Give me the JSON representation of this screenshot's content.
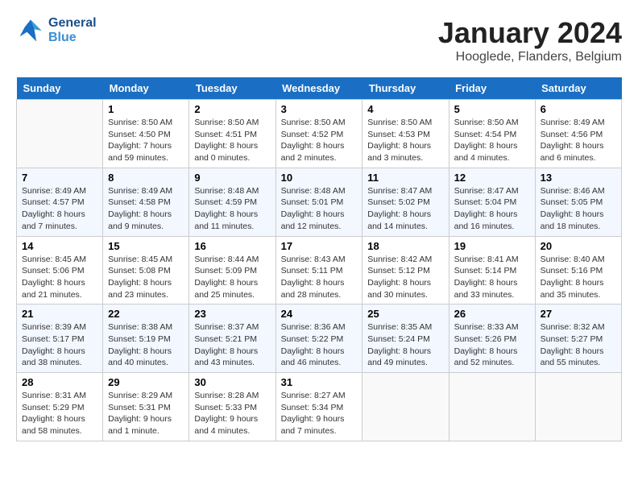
{
  "header": {
    "logo_line1": "General",
    "logo_line2": "Blue",
    "month_year": "January 2024",
    "location": "Hooglede, Flanders, Belgium"
  },
  "weekdays": [
    "Sunday",
    "Monday",
    "Tuesday",
    "Wednesday",
    "Thursday",
    "Friday",
    "Saturday"
  ],
  "weeks": [
    [
      {
        "day": "",
        "sunrise": "",
        "sunset": "",
        "daylight": ""
      },
      {
        "day": "1",
        "sunrise": "Sunrise: 8:50 AM",
        "sunset": "Sunset: 4:50 PM",
        "daylight": "Daylight: 7 hours and 59 minutes."
      },
      {
        "day": "2",
        "sunrise": "Sunrise: 8:50 AM",
        "sunset": "Sunset: 4:51 PM",
        "daylight": "Daylight: 8 hours and 0 minutes."
      },
      {
        "day": "3",
        "sunrise": "Sunrise: 8:50 AM",
        "sunset": "Sunset: 4:52 PM",
        "daylight": "Daylight: 8 hours and 2 minutes."
      },
      {
        "day": "4",
        "sunrise": "Sunrise: 8:50 AM",
        "sunset": "Sunset: 4:53 PM",
        "daylight": "Daylight: 8 hours and 3 minutes."
      },
      {
        "day": "5",
        "sunrise": "Sunrise: 8:50 AM",
        "sunset": "Sunset: 4:54 PM",
        "daylight": "Daylight: 8 hours and 4 minutes."
      },
      {
        "day": "6",
        "sunrise": "Sunrise: 8:49 AM",
        "sunset": "Sunset: 4:56 PM",
        "daylight": "Daylight: 8 hours and 6 minutes."
      }
    ],
    [
      {
        "day": "7",
        "sunrise": "Sunrise: 8:49 AM",
        "sunset": "Sunset: 4:57 PM",
        "daylight": "Daylight: 8 hours and 7 minutes."
      },
      {
        "day": "8",
        "sunrise": "Sunrise: 8:49 AM",
        "sunset": "Sunset: 4:58 PM",
        "daylight": "Daylight: 8 hours and 9 minutes."
      },
      {
        "day": "9",
        "sunrise": "Sunrise: 8:48 AM",
        "sunset": "Sunset: 4:59 PM",
        "daylight": "Daylight: 8 hours and 11 minutes."
      },
      {
        "day": "10",
        "sunrise": "Sunrise: 8:48 AM",
        "sunset": "Sunset: 5:01 PM",
        "daylight": "Daylight: 8 hours and 12 minutes."
      },
      {
        "day": "11",
        "sunrise": "Sunrise: 8:47 AM",
        "sunset": "Sunset: 5:02 PM",
        "daylight": "Daylight: 8 hours and 14 minutes."
      },
      {
        "day": "12",
        "sunrise": "Sunrise: 8:47 AM",
        "sunset": "Sunset: 5:04 PM",
        "daylight": "Daylight: 8 hours and 16 minutes."
      },
      {
        "day": "13",
        "sunrise": "Sunrise: 8:46 AM",
        "sunset": "Sunset: 5:05 PM",
        "daylight": "Daylight: 8 hours and 18 minutes."
      }
    ],
    [
      {
        "day": "14",
        "sunrise": "Sunrise: 8:45 AM",
        "sunset": "Sunset: 5:06 PM",
        "daylight": "Daylight: 8 hours and 21 minutes."
      },
      {
        "day": "15",
        "sunrise": "Sunrise: 8:45 AM",
        "sunset": "Sunset: 5:08 PM",
        "daylight": "Daylight: 8 hours and 23 minutes."
      },
      {
        "day": "16",
        "sunrise": "Sunrise: 8:44 AM",
        "sunset": "Sunset: 5:09 PM",
        "daylight": "Daylight: 8 hours and 25 minutes."
      },
      {
        "day": "17",
        "sunrise": "Sunrise: 8:43 AM",
        "sunset": "Sunset: 5:11 PM",
        "daylight": "Daylight: 8 hours and 28 minutes."
      },
      {
        "day": "18",
        "sunrise": "Sunrise: 8:42 AM",
        "sunset": "Sunset: 5:12 PM",
        "daylight": "Daylight: 8 hours and 30 minutes."
      },
      {
        "day": "19",
        "sunrise": "Sunrise: 8:41 AM",
        "sunset": "Sunset: 5:14 PM",
        "daylight": "Daylight: 8 hours and 33 minutes."
      },
      {
        "day": "20",
        "sunrise": "Sunrise: 8:40 AM",
        "sunset": "Sunset: 5:16 PM",
        "daylight": "Daylight: 8 hours and 35 minutes."
      }
    ],
    [
      {
        "day": "21",
        "sunrise": "Sunrise: 8:39 AM",
        "sunset": "Sunset: 5:17 PM",
        "daylight": "Daylight: 8 hours and 38 minutes."
      },
      {
        "day": "22",
        "sunrise": "Sunrise: 8:38 AM",
        "sunset": "Sunset: 5:19 PM",
        "daylight": "Daylight: 8 hours and 40 minutes."
      },
      {
        "day": "23",
        "sunrise": "Sunrise: 8:37 AM",
        "sunset": "Sunset: 5:21 PM",
        "daylight": "Daylight: 8 hours and 43 minutes."
      },
      {
        "day": "24",
        "sunrise": "Sunrise: 8:36 AM",
        "sunset": "Sunset: 5:22 PM",
        "daylight": "Daylight: 8 hours and 46 minutes."
      },
      {
        "day": "25",
        "sunrise": "Sunrise: 8:35 AM",
        "sunset": "Sunset: 5:24 PM",
        "daylight": "Daylight: 8 hours and 49 minutes."
      },
      {
        "day": "26",
        "sunrise": "Sunrise: 8:33 AM",
        "sunset": "Sunset: 5:26 PM",
        "daylight": "Daylight: 8 hours and 52 minutes."
      },
      {
        "day": "27",
        "sunrise": "Sunrise: 8:32 AM",
        "sunset": "Sunset: 5:27 PM",
        "daylight": "Daylight: 8 hours and 55 minutes."
      }
    ],
    [
      {
        "day": "28",
        "sunrise": "Sunrise: 8:31 AM",
        "sunset": "Sunset: 5:29 PM",
        "daylight": "Daylight: 8 hours and 58 minutes."
      },
      {
        "day": "29",
        "sunrise": "Sunrise: 8:29 AM",
        "sunset": "Sunset: 5:31 PM",
        "daylight": "Daylight: 9 hours and 1 minute."
      },
      {
        "day": "30",
        "sunrise": "Sunrise: 8:28 AM",
        "sunset": "Sunset: 5:33 PM",
        "daylight": "Daylight: 9 hours and 4 minutes."
      },
      {
        "day": "31",
        "sunrise": "Sunrise: 8:27 AM",
        "sunset": "Sunset: 5:34 PM",
        "daylight": "Daylight: 9 hours and 7 minutes."
      },
      {
        "day": "",
        "sunrise": "",
        "sunset": "",
        "daylight": ""
      },
      {
        "day": "",
        "sunrise": "",
        "sunset": "",
        "daylight": ""
      },
      {
        "day": "",
        "sunrise": "",
        "sunset": "",
        "daylight": ""
      }
    ]
  ]
}
